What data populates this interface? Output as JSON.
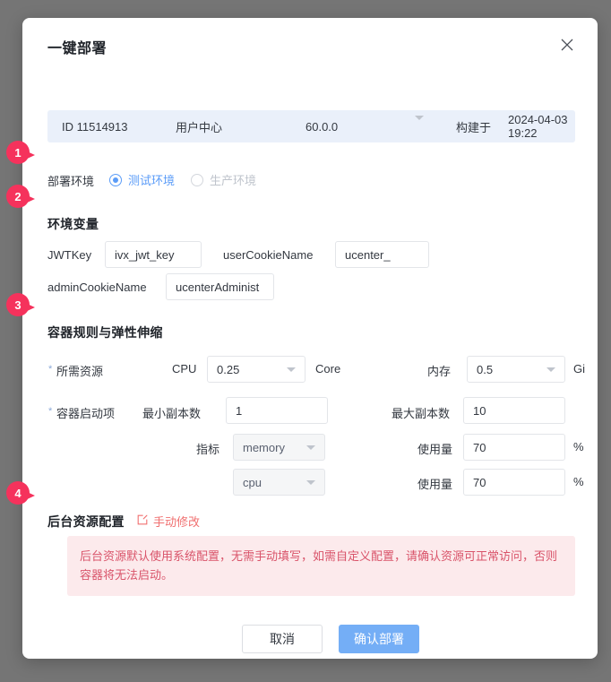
{
  "dialog": {
    "title": "一键部署",
    "close_icon": "close-icon"
  },
  "info_bar": {
    "id": "ID 11514913",
    "app_name": "用户中心",
    "version": "60.0.0",
    "version_caret_icon": "chevron-down-icon",
    "build_label": "构建于",
    "build_time": "2024-04-03 19:22"
  },
  "callouts": [
    {
      "number": "1"
    },
    {
      "number": "2"
    },
    {
      "number": "3"
    },
    {
      "number": "4"
    }
  ],
  "deploy_env": {
    "label": "部署环境",
    "options": [
      {
        "label": "测试环境",
        "selected": true,
        "disabled": false
      },
      {
        "label": "生产环境",
        "selected": false,
        "disabled": true
      }
    ]
  },
  "env_vars": {
    "title": "环境变量",
    "fields": [
      {
        "label": "JWTKey",
        "value": "ivx_jwt_key"
      },
      {
        "label": "userCookieName",
        "value": "ucenter_"
      },
      {
        "label": "adminCookieName",
        "value": "ucenterAdminist"
      }
    ]
  },
  "container": {
    "title": "容器规则与弹性伸缩",
    "required_star": "*",
    "resource_label": "所需资源",
    "cpu_label": "CPU",
    "cpu_value": "0.25",
    "cpu_unit": "Core",
    "mem_label": "内存",
    "mem_value": "0.5",
    "mem_unit": "Gi",
    "startup_label": "容器启动项",
    "min_replica_label": "最小副本数",
    "min_replica_value": "1",
    "max_replica_label": "最大副本数",
    "max_replica_value": "10",
    "metric_label": "指标",
    "metrics": [
      {
        "name": "memory",
        "usage_label": "使用量",
        "usage_value": "70",
        "unit": "%"
      },
      {
        "name": "cpu",
        "usage_label": "使用量",
        "usage_value": "70",
        "unit": "%"
      }
    ]
  },
  "backend": {
    "title": "后台资源配置",
    "manual_link": "手动修改",
    "manual_icon": "external-edit-icon",
    "warning": "后台资源默认使用系统配置，无需手动填写，如需自定义配置，请确认资源可正常访问，否则容器将无法启动。"
  },
  "footer": {
    "cancel_label": "取消",
    "confirm_label": "确认部署"
  },
  "colors": {
    "accent_blue": "#5b9cf8",
    "button_blue": "#74aef6",
    "badge_pink": "#f5325c",
    "warning_bg": "#fceaec",
    "warning_text": "#d9546a",
    "info_bar_bg": "#eaf0fa"
  }
}
